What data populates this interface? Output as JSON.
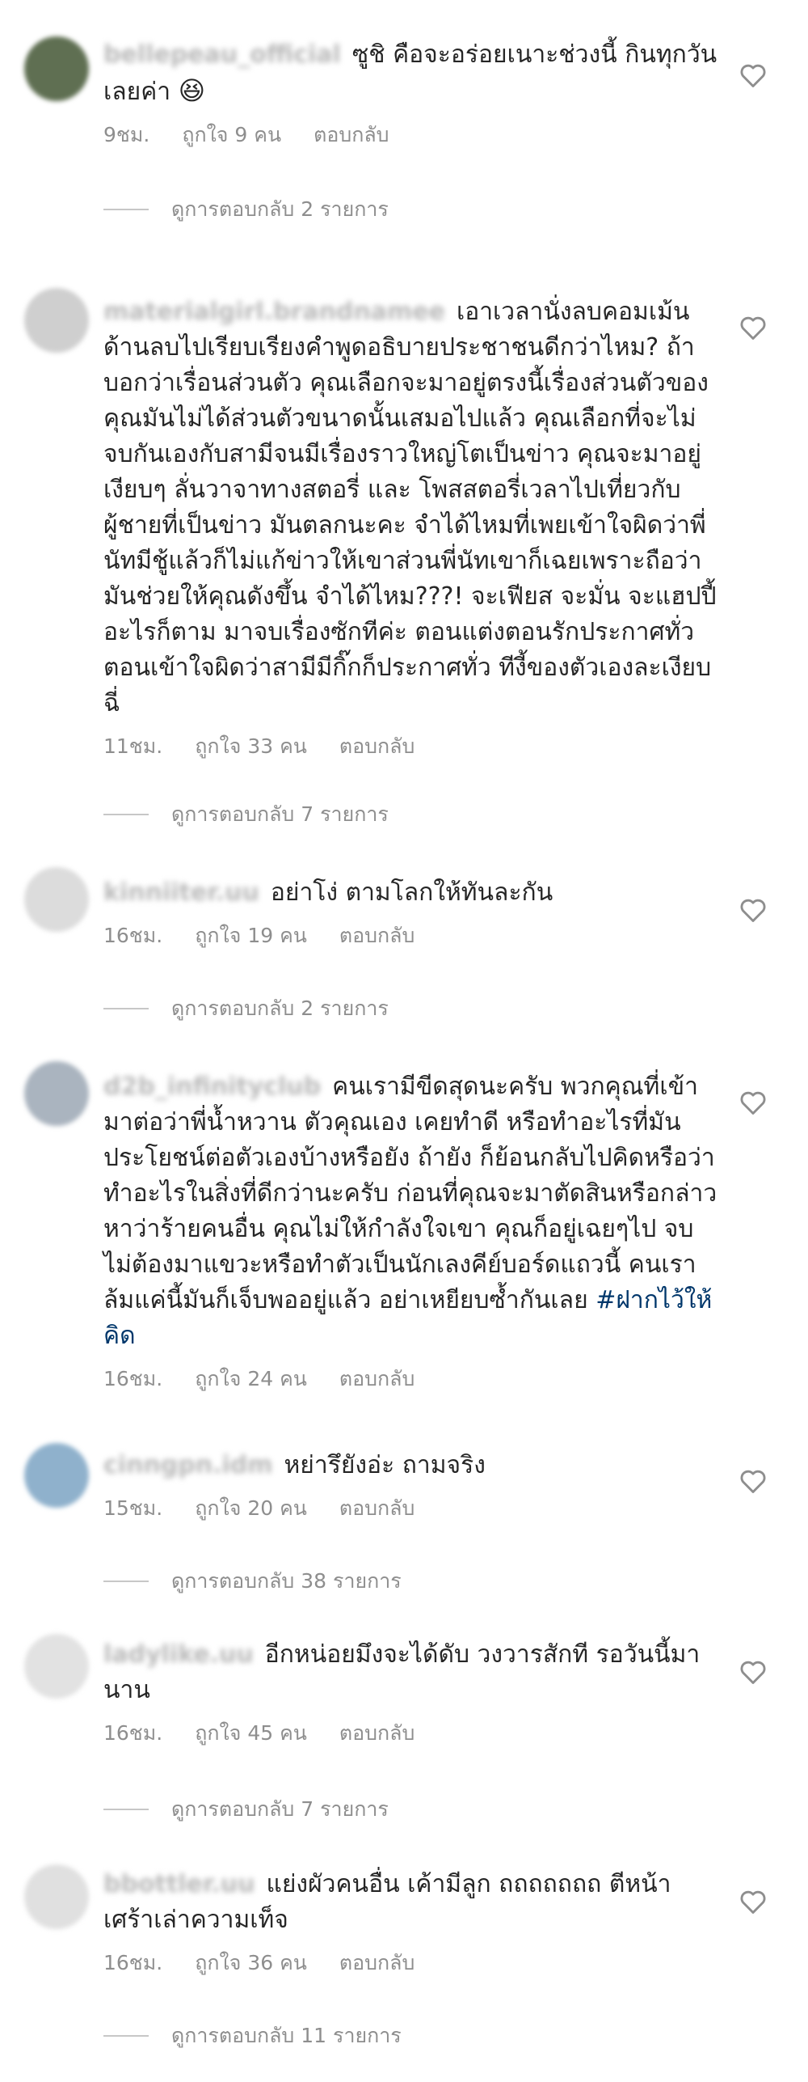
{
  "ui": {
    "like_action": "ถูกใจ",
    "like_unit": "คน",
    "reply_action": "ตอบกลับ",
    "view_replies_prefix": "ดูการตอบกลับ",
    "view_replies_suffix": "รายการ",
    "heart_icon": "heart-outline-icon"
  },
  "comments": [
    {
      "username": "bellepeau_official",
      "text": "ซูชิ คือจะอร่อยเนาะช่วงนี้ กินทุกวันเลยค่า",
      "emoji": "😆",
      "time": "9ชม.",
      "likes": "9",
      "replies": "2",
      "avatar_color": "#5f6f52"
    },
    {
      "username": "materialgirl.brandnamee",
      "text": "เอาเวลานั่งลบคอมเม้นด้านลบไปเรียบเรียงคำพูดอธิบายประชาชนดีกว่าไหม? ถ้าบอกว่าเรื่อนส่วนตัว คุณเลือกจะมาอยู่ตรงนี้เรื่องส่วนตัวของคุณมันไม่ได้ส่วนตัวขนาดนั้นเสมอไปแล้ว คุณเลือกที่จะไม่จบกันเองกับสามีจนมีเรื่องราวใหญ่โตเป็นข่าว คุณจะมาอยู่เงียบๆ ลั่นวาจาทางสตอรี่ และ โพสสตอรี่เวลาไปเที่ยวกับผู้ชายที่เป็นข่าว มันตลกนะคะ จำได้ไหมที่เพยเข้าใจผิดว่าพี่นัทมีชู้แล้วก็ไม่แก้ข่าวให้เขาส่วนพี่นัทเขาก็เฉยเพราะถือว่ามันช่วยให้คุณดังขึ้น จำได้ไหม???! จะเฟียส จะมั่น จะแฮปปี้อะไรก็ตาม มาจบเรื่องซักทีค่ะ ตอนแต่งตอนรักประกาศทั่ว ตอนเข้าใจผิดว่าสามีมีกิ๊กก็ประกาศทั่ว ทีงี้ของตัวเองละเงียบฉี่",
      "time": "11ชม.",
      "likes": "33",
      "replies": "7",
      "avatar_color": "#cfcfcf"
    },
    {
      "username": "kinniiter.uu",
      "text": "อย่าโง่ ตามโลกให้ทันละกัน",
      "time": "16ชม.",
      "likes": "19",
      "replies": "2",
      "avatar_color": "#dcdcdc"
    },
    {
      "username": "d2b_infinityclub",
      "text": "คนเรามีขีดสุดนะครับ พวกคุณที่เข้ามาต่อว่าพี่น้ำหวาน ตัวคุณเอง เคยทำดี หรือทำอะไรที่มันประโยชน์ต่อตัวเองบ้างหรือยัง ถ้ายัง ก็ย้อนกลับไปคิดหรือว่าทำอะไรในสิ่งที่ดีกว่านะครับ ก่อนที่คุณจะมาตัดสินหรือกล่าวหาว่าร้ายคนอื่น คุณไม่ให้กำลังใจเขา คุณก็อยู่เฉยๆไป จบ ไม่ต้องมาแขวะหรือทำตัวเป็นนักเลงคีย์บอร์ดแถวนี้ คนเราล้มแค่นี้มันก็เจ็บพออยู่แล้ว อย่าเหยียบซ้ำกันเลย",
      "hashtag": "#ฝากไว้ให้คิด",
      "time": "16ชม.",
      "likes": "24",
      "avatar_color": "#aab4bf"
    },
    {
      "username": "cinngpn.idm",
      "text": "หย่ารึยังอ่ะ ถามจริง",
      "time": "15ชม.",
      "likes": "20",
      "replies": "38",
      "avatar_color": "#8fb1cc"
    },
    {
      "username": "ladylike.uu",
      "text": "อีกหน่อยมึงจะได้ดับ วงวารสักที รอวันนี้มานาน",
      "time": "16ชม.",
      "likes": "45",
      "replies": "7",
      "avatar_color": "#e2e2e2"
    },
    {
      "username": "bbottler.uu",
      "text": "แย่งผัวคนอื่น เค้ามีลูก ถถถถถถถ ตีหน้าเศร้าเล่าความเท็จ",
      "time": "16ชม.",
      "likes": "36",
      "replies": "11",
      "avatar_color": "#e0e0e0"
    }
  ]
}
